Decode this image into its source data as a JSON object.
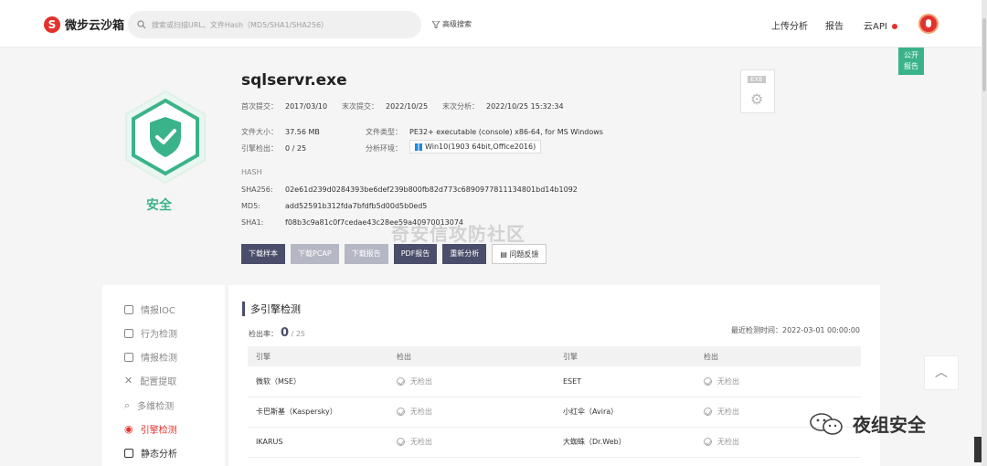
{
  "topbar": {
    "logo_mark": "S",
    "logo_text": "微步云沙箱",
    "search_placeholder": "搜索或扫描URL、文件Hash（MD5/SHA1/SHA256）",
    "advanced_search": "高级搜索",
    "nav": {
      "upload": "上传分析",
      "report": "报告",
      "api": "云API"
    }
  },
  "public_report": {
    "line1": "公开",
    "line2": "报告"
  },
  "verdict": {
    "label": "安全",
    "color": "#3bb38a"
  },
  "file": {
    "name": "sqlservr.exe",
    "first_submit_label": "首次提交：",
    "first_submit": "2017/03/10",
    "last_submit_label": "末次提交：",
    "last_submit": "2022/10/25",
    "last_analysis_label": "末次分析：",
    "last_analysis": "2022/10/25 15:32:34",
    "size_label": "文件大小：",
    "size": "37.56 MB",
    "type_label": "文件类型：",
    "type": "PE32+ executable (console) x86-64, for MS Windows",
    "engine_label": "引擎检出：",
    "engine": "0 / 25",
    "env_label": "分析环境：",
    "env": "Win10(1903 64bit,Office2016)",
    "icon_label": "EXE"
  },
  "hash": {
    "title": "HASH",
    "sha256_label": "SHA256:",
    "sha256": "02e61d239d0284393be6def239b800fb82d773c6890977811134801bd14b1092",
    "md5_label": "MD5:",
    "md5": "add52591b312fda7bfdfb5d00d5b0ed5",
    "sha1_label": "SHA1:",
    "sha1": "f08b3c9a81c0f7cedae43c28ee59a40970013074"
  },
  "buttons": {
    "download_sample": "下载样本",
    "download_pcap": "下载PCAP",
    "download_report": "下载报告",
    "pdf_report": "PDF报告",
    "reanalyze": "重新分析",
    "feedback": "问题反馈"
  },
  "watermark": "奇安信攻防社区",
  "sidebar": {
    "items": [
      {
        "label": "情报IOC"
      },
      {
        "label": "行为检测"
      },
      {
        "label": "情报检测"
      },
      {
        "label": "配置提取"
      },
      {
        "label": "多维检测"
      },
      {
        "label": "引擎检测"
      },
      {
        "label": "静态分析"
      }
    ]
  },
  "engines": {
    "title": "多引擎检测",
    "rate_label": "检出率：",
    "rate_value": "0",
    "rate_total": "/ 25",
    "latest_label": "最近检测时间：",
    "latest_time": "2022-03-01 00:00:00",
    "headers": [
      "引擎",
      "检出",
      "引擎",
      "检出"
    ],
    "rows": [
      {
        "e1": "微软（MSE）",
        "r1": "无检出",
        "e2": "ESET",
        "r2": "无检出"
      },
      {
        "e1": "卡巴斯基（Kaspersky）",
        "r1": "无检出",
        "e2": "小红伞（Avira）",
        "r2": "无检出"
      },
      {
        "e1": "IKARUS",
        "r1": "无检出",
        "e2": "大蜘蛛（Dr.Web）",
        "r2": "无检出"
      }
    ]
  },
  "wechat": {
    "account": "夜组安全"
  }
}
